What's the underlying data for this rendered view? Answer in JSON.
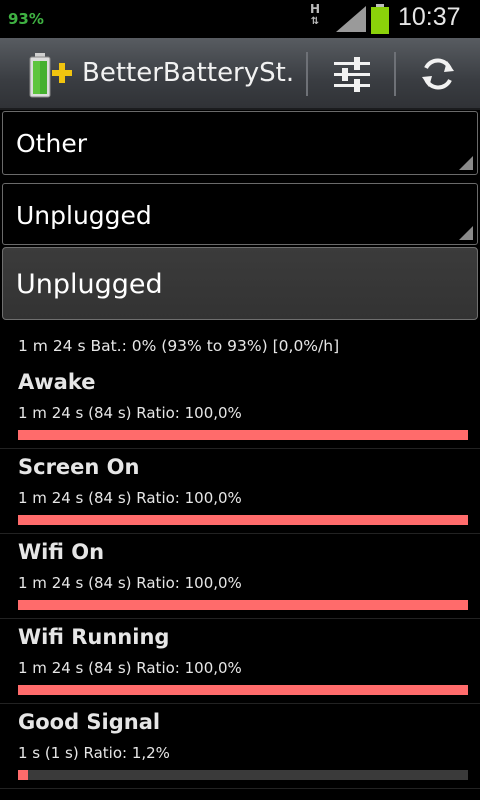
{
  "status_bar": {
    "battery_percent": "93%",
    "network_type": "H",
    "time": "10:37"
  },
  "action_bar": {
    "title": "BetterBatterySt..",
    "icons": [
      "battery-plus-icon",
      "sliders-icon",
      "refresh-icon"
    ]
  },
  "filters": {
    "stat_type": "Other",
    "since": "Unplugged",
    "reference_button": "Unplugged"
  },
  "summary": "1 m 24 s  Bat.: 0% (93% to 93%) [0,0%/h]",
  "stats": [
    {
      "name": "Awake",
      "detail": "1 m 24 s  (84 s) Ratio: 100,0%",
      "ratio": 1.0
    },
    {
      "name": "Screen On",
      "detail": "1 m 24 s  (84 s) Ratio: 100,0%",
      "ratio": 1.0
    },
    {
      "name": "Wifi On",
      "detail": "1 m 24 s  (84 s) Ratio: 100,0%",
      "ratio": 1.0
    },
    {
      "name": "Wifi Running",
      "detail": "1 m 24 s  (84 s) Ratio: 100,0%",
      "ratio": 1.0
    },
    {
      "name": "Good Signal",
      "detail": "1 s  (1 s) Ratio: 1,2%",
      "ratio": 0.012
    }
  ],
  "colors": {
    "bar_fill": "#ff6b6b",
    "bar_track": "#3a3a3a",
    "battery_green": "#8bd10a",
    "battery_text": "#3fb142"
  }
}
